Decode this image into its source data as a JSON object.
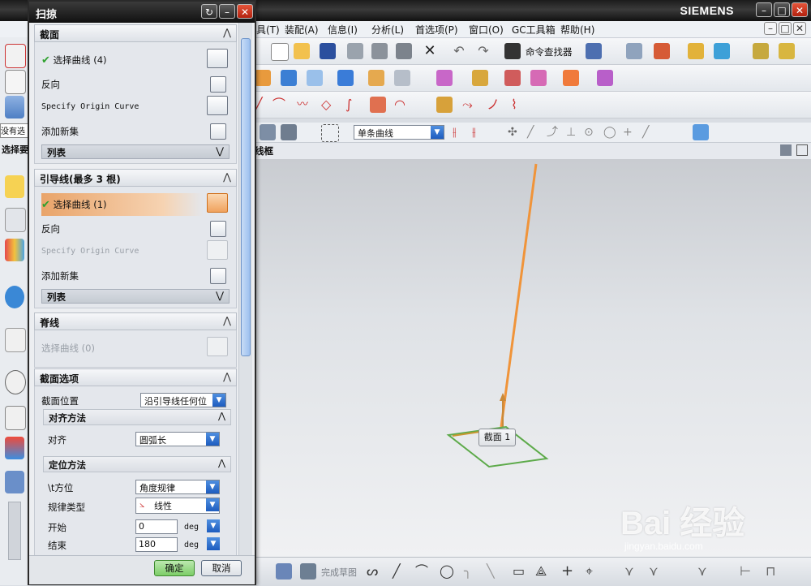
{
  "app": {
    "brand": "SIEMENS",
    "menus": [
      "具(T)",
      "装配(A)",
      "信息(I)",
      "分析(L)",
      "首选项(P)",
      "窗口(O)",
      "GC工具箱",
      "帮助(H)"
    ],
    "command_finder": "命令查找器",
    "selection_filter": "单条曲线",
    "left_combo": "没有选",
    "select_bar_label": "选择要",
    "graphics_header": "线框",
    "bottom_label": "完成草图"
  },
  "dialog": {
    "title": "扫掠",
    "section_curve": {
      "title": "截面",
      "select_curve": "选择曲线 (4)",
      "reverse": "反向",
      "origin": "Specify Origin Curve",
      "add_set": "添加新集",
      "list": "列表"
    },
    "section_guide": {
      "title": "引导线(最多 3 根)",
      "select_curve": "选择曲线 (1)",
      "reverse": "反向",
      "origin": "Specify Origin Curve",
      "add_set": "添加新集",
      "list": "列表"
    },
    "section_spine": {
      "title": "脊线",
      "select_curve": "选择曲线 (0)"
    },
    "section_options": {
      "title": "截面选项",
      "position_label": "截面位置",
      "position_value": "沿引导线任何位",
      "align": {
        "title": "对齐方法",
        "label": "对齐",
        "value": "圆弧长"
      },
      "orient": {
        "title": "定位方法",
        "orient_label": "\\t方位",
        "orient_value": "角度规律",
        "law_label": "规律类型",
        "law_value": "线性",
        "start_label": "开始",
        "start_value": "0",
        "end_label": "结束",
        "end_value": "180",
        "unit": "deg"
      }
    },
    "ok": "确定",
    "cancel": "取消"
  },
  "viewport": {
    "tag": "截面 1"
  },
  "watermark": {
    "main": "Bai 经验",
    "sub": "jingyan.baidu.com"
  },
  "colors": {
    "guide_curve": "#f0943a",
    "section_curve": "#5daa4a"
  }
}
